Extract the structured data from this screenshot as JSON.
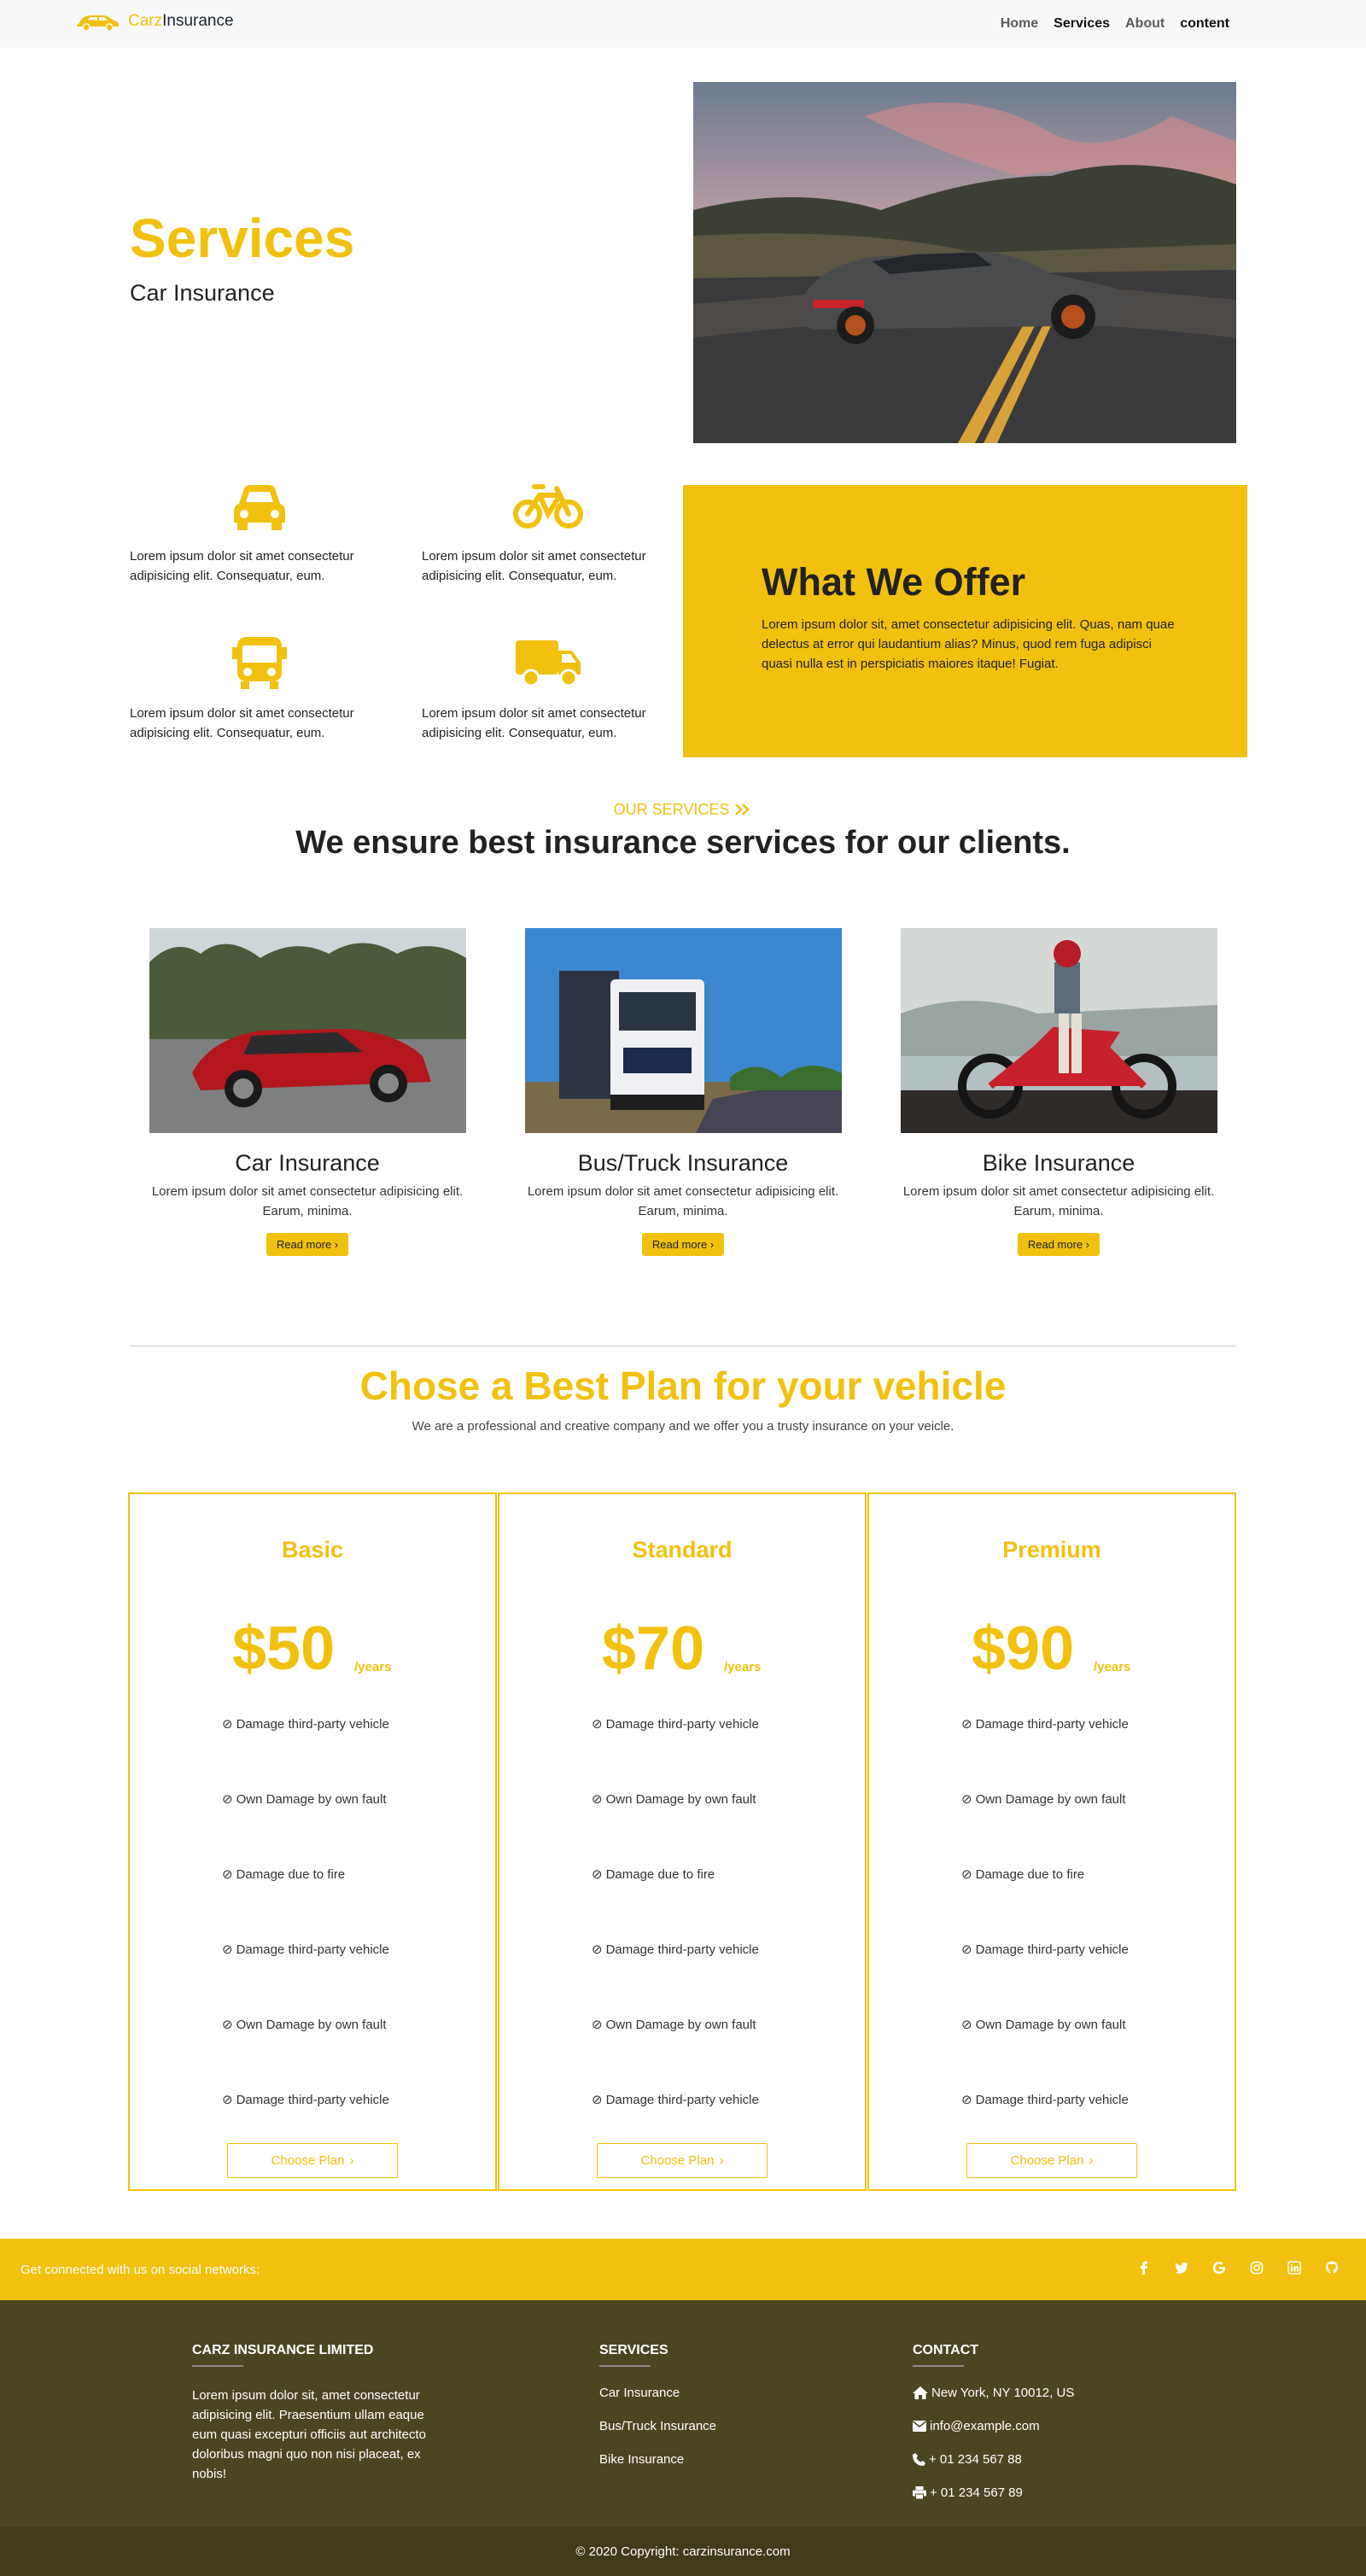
{
  "nav": {
    "brand_part1": "Carz",
    "brand_part2": "Insurance",
    "links": [
      "Home",
      "Services",
      "About",
      "content"
    ]
  },
  "hero": {
    "title": "Services",
    "subtitle": "Car Insurance"
  },
  "features": [
    {
      "icon": "car-icon",
      "text": "Lorem ipsum dolor sit amet consectetur adipisicing elit. Consequatur, eum."
    },
    {
      "icon": "bicycle-icon",
      "text": "Lorem ipsum dolor sit amet consectetur adipisicing elit. Consequatur, eum."
    },
    {
      "icon": "bus-icon",
      "text": "Lorem ipsum dolor sit amet consectetur adipisicing elit. Consequatur, eum."
    },
    {
      "icon": "truck-icon",
      "text": "Lorem ipsum dolor sit amet consectetur adipisicing elit. Consequatur, eum."
    }
  ],
  "offer": {
    "title": "What We Offer",
    "text": "Lorem ipsum dolor sit, amet consectetur adipisicing elit. Quas, nam quae delectus at error qui laudantium alias? Minus, quod rem fuga adipisci quasi nulla est in perspiciatis maiores itaque! Fugiat."
  },
  "services_section": {
    "eyebrow": "OUR SERVICES",
    "title": "We ensure best insurance services for our clients."
  },
  "services": [
    {
      "title": "Car Insurance",
      "text": "Lorem ipsum dolor sit amet consectetur adipisicing elit. Earum, minima.",
      "button": "Read more"
    },
    {
      "title": "Bus/Truck Insurance",
      "text": "Lorem ipsum dolor sit amet consectetur adipisicing elit. Earum, minima.",
      "button": "Read more"
    },
    {
      "title": "Bike Insurance",
      "text": "Lorem ipsum dolor sit amet consectetur adipisicing elit. Earum, minima.",
      "button": "Read more"
    }
  ],
  "plans_section": {
    "title": "Chose a Best Plan for your vehicle",
    "subtitle": "We are a professional and creative company and we offer you a trusty insurance on your veicle."
  },
  "plans": [
    {
      "name": "Basic",
      "price": "$50",
      "period": "/years",
      "button": "Choose Plan",
      "features": [
        "Damage third-party vehicle",
        "Own Damage by own fault",
        "Damage due to fire",
        "Damage third-party vehicle",
        "Own Damage by own fault",
        "Damage third-party vehicle"
      ]
    },
    {
      "name": "Standard",
      "price": "$70",
      "period": "/years",
      "button": "Choose Plan",
      "features": [
        "Damage third-party vehicle",
        "Own Damage by own fault",
        "Damage due to fire",
        "Damage third-party vehicle",
        "Own Damage by own fault",
        "Damage third-party vehicle"
      ]
    },
    {
      "name": "Premium",
      "price": "$90",
      "period": "/years",
      "button": "Choose Plan",
      "features": [
        "Damage third-party vehicle",
        "Own Damage by own fault",
        "Damage due to fire",
        "Damage third-party vehicle",
        "Own Damage by own fault",
        "Damage third-party vehicle"
      ]
    }
  ],
  "social": {
    "text": "Get connected with us on social networks:",
    "icons": [
      "facebook-icon",
      "twitter-icon",
      "google-icon",
      "instagram-icon",
      "linkedin-icon",
      "github-icon"
    ]
  },
  "footer": {
    "company_title": "CARZ INSURANCE LIMITED",
    "company_text": "Lorem ipsum dolor sit, amet consectetur adipisicing elit. Praesentium ullam eaque eum quasi excepturi officiis aut architecto doloribus magni quo non nisi placeat, ex nobis!",
    "services_title": "SERVICES",
    "services_links": [
      "Car Insurance",
      "Bus/Truck Insurance",
      "Bike Insurance"
    ],
    "contact_title": "CONTACT",
    "address": "New York, NY 10012, US",
    "email": "info@example.com",
    "phone": "+ 01 234 567 88",
    "fax": "+ 01 234 567 89"
  },
  "copyright": "© 2020 Copyright: carzinsurance.com",
  "colors": {
    "accent": "#f2c10f",
    "footer": "#4b4622",
    "footer_bottom": "#403b1b"
  }
}
